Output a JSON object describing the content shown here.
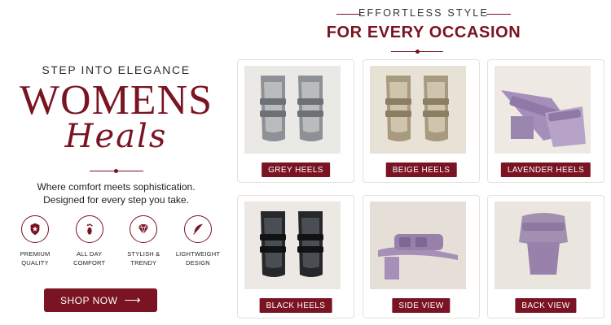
{
  "hero": {
    "eyebrow": "STEP INTO ELEGANCE",
    "title": "WOMENS",
    "script_title": "Heals",
    "tagline_line1": "Where comfort meets sophistication.",
    "tagline_line2": "Designed for every step you take."
  },
  "features": [
    {
      "icon": "star-badge-icon",
      "line1": "PREMIUM",
      "line2": "QUALITY"
    },
    {
      "icon": "footprint-icon",
      "line1": "ALL DAY",
      "line2": "COMFORT"
    },
    {
      "icon": "diamond-icon",
      "line1": "STYLISH &",
      "line2": "TRENDY"
    },
    {
      "icon": "feather-icon",
      "line1": "LIGHTWEIGHT",
      "line2": "DESIGN"
    }
  ],
  "cta": {
    "label": "SHOP NOW",
    "arrow": "⟶"
  },
  "collection": {
    "eyebrow": "EFFORTLESS STYLE",
    "title": "FOR EVERY OCCASION"
  },
  "products": [
    {
      "label": "GREY HEELS",
      "color": "#8d9094",
      "bg": "#ebe9e6"
    },
    {
      "label": "BEIGE HEELS",
      "color": "#a89a7e",
      "bg": "#e8e1d6"
    },
    {
      "label": "LAVENDER HEELS",
      "color": "#a58fba",
      "bg": "#efe9e3"
    },
    {
      "label": "BLACK HEELS",
      "color": "#25272b",
      "bg": "#ece9e5"
    },
    {
      "label": "SIDE VIEW",
      "color": "#a690b7",
      "bg": "#e6dfd8"
    },
    {
      "label": "BACK VIEW",
      "color": "#a38fb2",
      "bg": "#ebe5df"
    }
  ],
  "colors": {
    "brand": "#7a1322"
  }
}
